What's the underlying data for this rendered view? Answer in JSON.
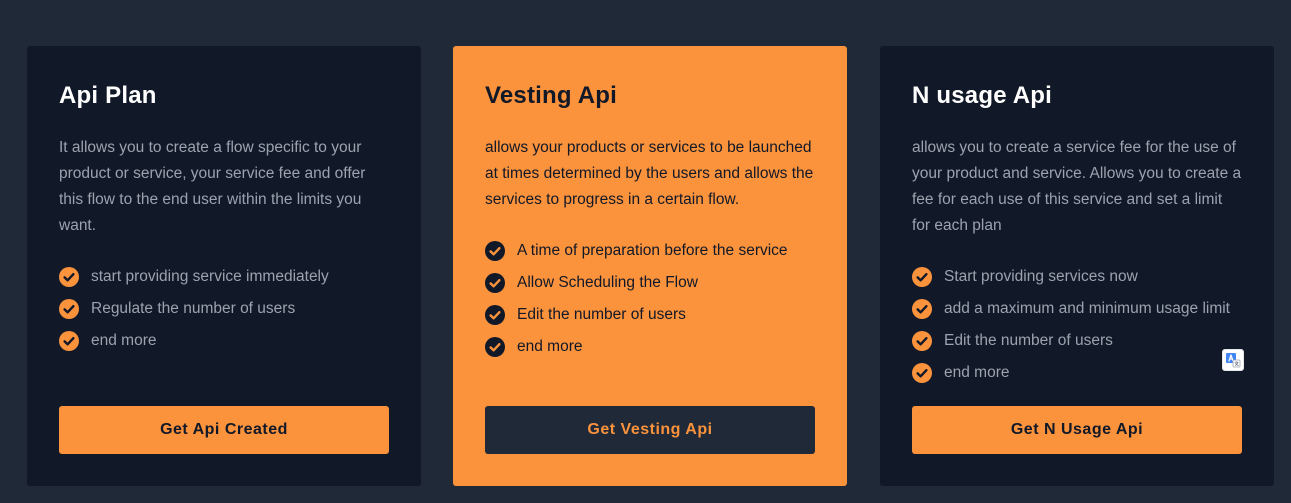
{
  "colors": {
    "page_background": "#1f2937",
    "card_dark": "#111827",
    "accent": "#fb923c",
    "muted_text": "#9ca3af"
  },
  "plans": [
    {
      "title": "Api Plan",
      "description": "It allows you to create a flow specific to your product or service, your service fee and offer this flow to the end user within the limits you want.",
      "features": [
        "start providing service immediately",
        "Regulate the number of users",
        "end more"
      ],
      "button_label": "Get Api Created",
      "highlighted": false
    },
    {
      "title": "Vesting Api",
      "description": "allows your products or services to be launched at times determined by the users and allows the services to progress in a certain flow.",
      "features": [
        "A time of preparation before the service",
        "Allow Scheduling the Flow",
        "Edit the number of users",
        "end more"
      ],
      "button_label": "Get Vesting Api",
      "highlighted": true
    },
    {
      "title": "N usage Api",
      "description": "allows you to create a service fee for the use of your product and service. Allows you to create a fee for each use of this service and set a limit for each plan",
      "features": [
        "Start providing services now",
        "add a maximum and minimum usage limit",
        "Edit the number of users",
        "end more"
      ],
      "button_label": "Get N Usage Api",
      "highlighted": false
    }
  ],
  "icons": {
    "feature": "check-circle-icon",
    "translate": "translate-icon"
  }
}
